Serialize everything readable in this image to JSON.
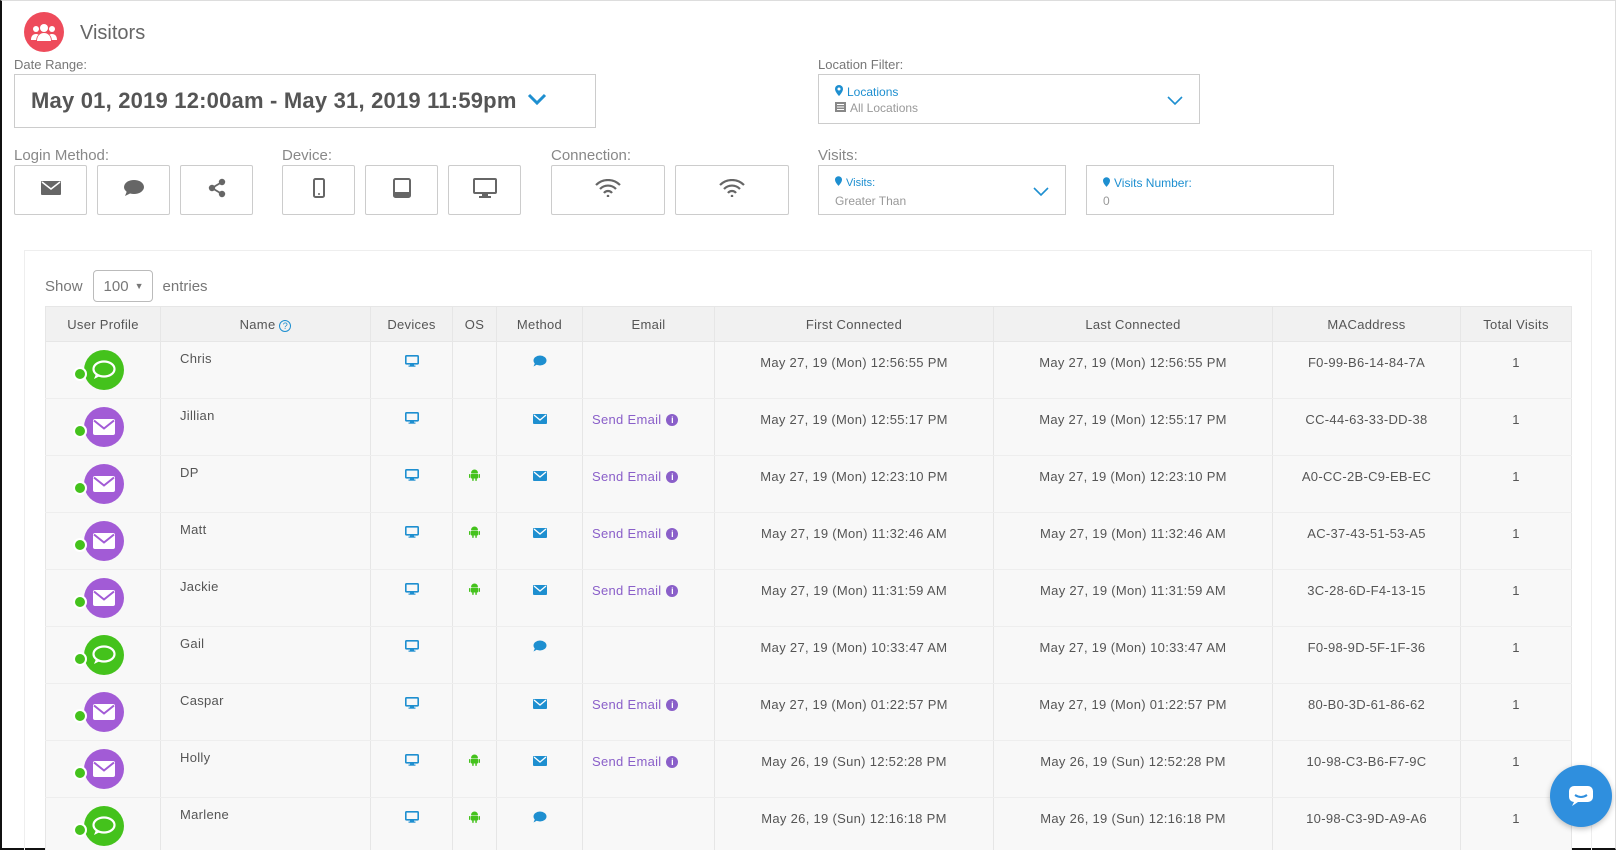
{
  "page": {
    "title": "Visitors",
    "title_icon": "users-icon"
  },
  "filters": {
    "date_range_label": "Date Range:",
    "date_range_value": "May 01, 2019 12:00am - May 31, 2019 11:59pm",
    "location_label": "Location Filter:",
    "location_select_label": "Locations",
    "location_select_value": "All Locations",
    "login_method_label": "Login Method:",
    "login_methods": [
      "email-icon",
      "chat-icon",
      "share-icon"
    ],
    "device_label": "Device:",
    "devices": [
      "phone-icon",
      "tablet-icon",
      "desktop-icon"
    ],
    "connection_label": "Connection:",
    "connections": [
      "wifi-icon",
      "wifi-icon"
    ],
    "visits_label": "Visits:",
    "visits_select_label": "Visits:",
    "visits_select_value": "Greater Than",
    "visits_number_label": "Visits Number:",
    "visits_number_value": "0"
  },
  "table_controls": {
    "show_label": "Show",
    "entries_value": "100",
    "entries_label": "entries"
  },
  "table": {
    "columns": [
      "User Profile",
      "Name",
      "Devices",
      "OS",
      "Method",
      "Email",
      "First Connected",
      "Last Connected",
      "MACaddress",
      "Total Visits"
    ],
    "rows": [
      {
        "profile": "chat",
        "name": "Chris",
        "device": "desktop-icon",
        "os": "",
        "method": "chat-icon",
        "email": "",
        "first": "May 27, 19 (Mon) 12:56:55 PM",
        "last": "May 27, 19 (Mon) 12:56:55 PM",
        "mac": "F0-99-B6-14-84-7A",
        "visits": "1"
      },
      {
        "profile": "email",
        "name": "Jillian",
        "device": "desktop-icon",
        "os": "",
        "method": "email-icon",
        "email": "Send Email",
        "first": "May 27, 19 (Mon) 12:55:17 PM",
        "last": "May 27, 19 (Mon) 12:55:17 PM",
        "mac": "CC-44-63-33-DD-38",
        "visits": "1"
      },
      {
        "profile": "email",
        "name": "DP",
        "device": "desktop-icon",
        "os": "android-icon",
        "method": "email-icon",
        "email": "Send Email",
        "first": "May 27, 19 (Mon) 12:23:10 PM",
        "last": "May 27, 19 (Mon) 12:23:10 PM",
        "mac": "A0-CC-2B-C9-EB-EC",
        "visits": "1"
      },
      {
        "profile": "email",
        "name": "Matt",
        "device": "desktop-icon",
        "os": "android-icon",
        "method": "email-icon",
        "email": "Send Email",
        "first": "May 27, 19 (Mon) 11:32:46 AM",
        "last": "May 27, 19 (Mon) 11:32:46 AM",
        "mac": "AC-37-43-51-53-A5",
        "visits": "1"
      },
      {
        "profile": "email",
        "name": "Jackie",
        "device": "desktop-icon",
        "os": "android-icon",
        "method": "email-icon",
        "email": "Send Email",
        "first": "May 27, 19 (Mon) 11:31:59 AM",
        "last": "May 27, 19 (Mon) 11:31:59 AM",
        "mac": "3C-28-6D-F4-13-15",
        "visits": "1"
      },
      {
        "profile": "chat",
        "name": "Gail",
        "device": "desktop-icon",
        "os": "",
        "method": "chat-icon",
        "email": "",
        "first": "May 27, 19 (Mon) 10:33:47 AM",
        "last": "May 27, 19 (Mon) 10:33:47 AM",
        "mac": "F0-98-9D-5F-1F-36",
        "visits": "1"
      },
      {
        "profile": "email",
        "name": "Caspar",
        "device": "desktop-icon",
        "os": "",
        "method": "email-icon",
        "email": "Send Email",
        "first": "May 27, 19 (Mon) 01:22:57 PM",
        "last": "May 27, 19 (Mon) 01:22:57 PM",
        "mac": "80-B0-3D-61-86-62",
        "visits": "1"
      },
      {
        "profile": "email",
        "name": "Holly",
        "device": "desktop-icon",
        "os": "android-icon",
        "method": "email-icon",
        "email": "Send Email",
        "first": "May 26, 19 (Sun) 12:52:28 PM",
        "last": "May 26, 19 (Sun) 12:52:28 PM",
        "mac": "10-98-C3-B6-F7-9C",
        "visits": "1"
      },
      {
        "profile": "chat",
        "name": "Marlene",
        "device": "desktop-icon",
        "os": "android-icon",
        "method": "chat-icon",
        "email": "",
        "first": "May 26, 19 (Sun) 12:16:18 PM",
        "last": "May 26, 19 (Sun) 12:16:18 PM",
        "mac": "10-98-C3-9D-A9-A6",
        "visits": "1"
      }
    ]
  },
  "colors": {
    "accent": "#1e8fd0",
    "chat_green": "#44c21c",
    "email_purple": "#a25bd6",
    "title_red": "#ee4b5b"
  },
  "chat_widget": {
    "icon": "chat-bubble-icon"
  }
}
